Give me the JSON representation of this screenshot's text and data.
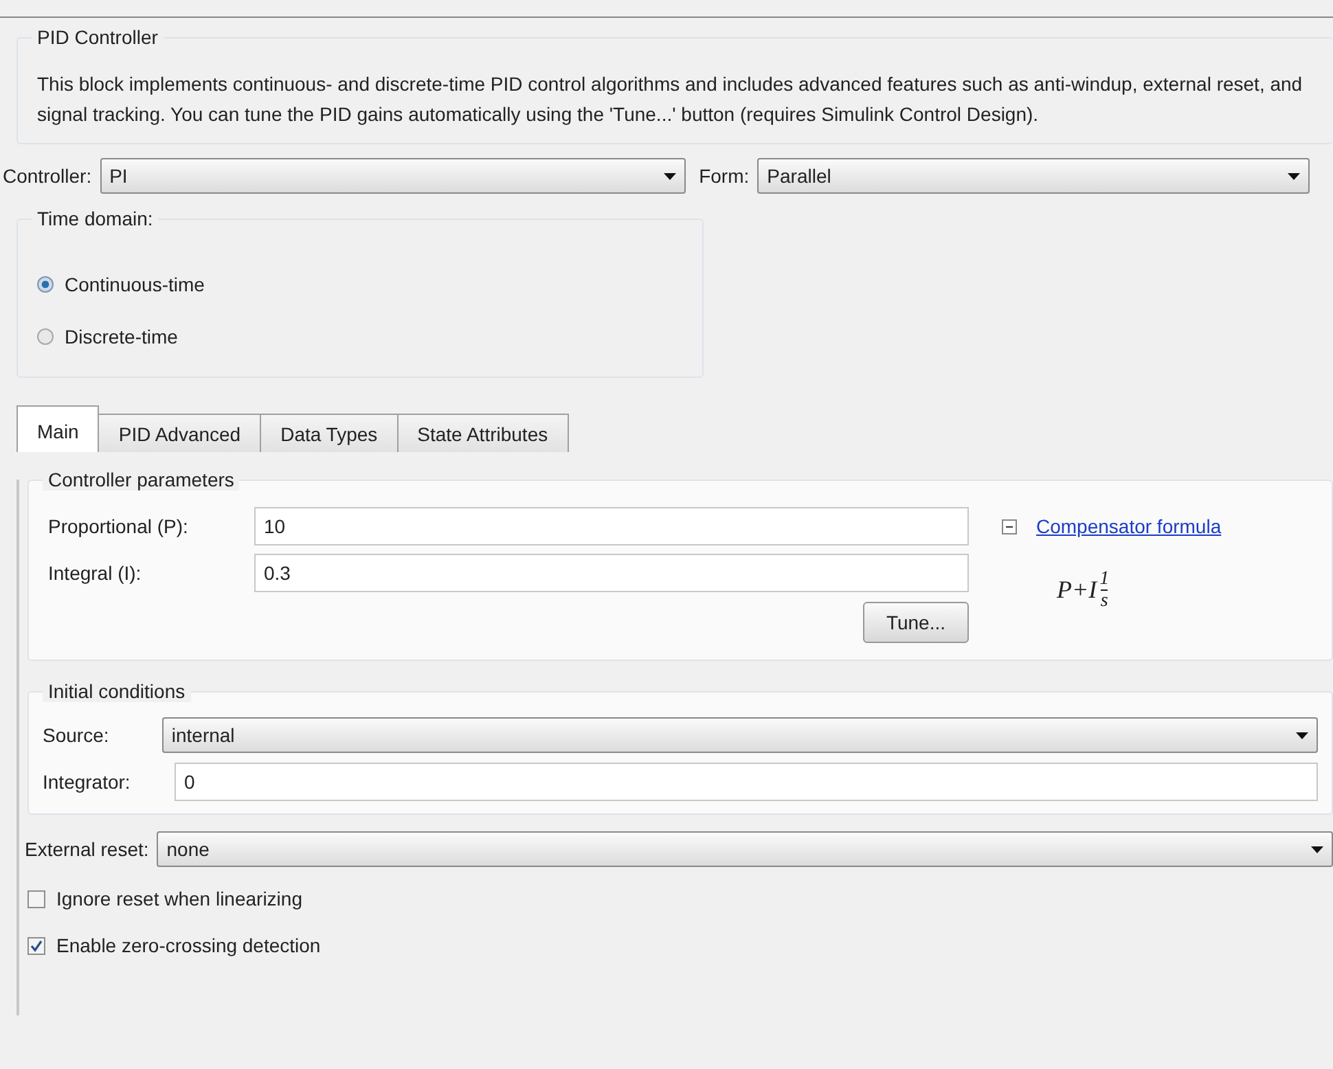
{
  "block": {
    "title": "PID Controller",
    "description": "This block implements continuous- and discrete-time PID control algorithms and includes advanced features such as anti-windup, external reset, and signal tracking. You can tune the PID gains automatically using the 'Tune...' button (requires Simulink Control Design)."
  },
  "controller": {
    "label": "Controller:",
    "value": "PI"
  },
  "form": {
    "label": "Form:",
    "value": "Parallel"
  },
  "time_domain": {
    "title": "Time domain:",
    "options": [
      {
        "label": "Continuous-time",
        "selected": true
      },
      {
        "label": "Discrete-time",
        "selected": false
      }
    ]
  },
  "tabs": [
    {
      "label": "Main",
      "selected": true
    },
    {
      "label": "PID Advanced",
      "selected": false
    },
    {
      "label": "Data Types",
      "selected": false
    },
    {
      "label": "State Attributes",
      "selected": false
    }
  ],
  "controller_parameters": {
    "title": "Controller parameters",
    "fields": [
      {
        "label": "Proportional (P):",
        "value": "10"
      },
      {
        "label": "Integral (I):",
        "value": "0.3"
      }
    ],
    "tune_button": "Tune...",
    "formula_link": "Compensator formula",
    "formula": {
      "terms": "P+I",
      "numerator": "1",
      "denominator": "s"
    }
  },
  "initial_conditions": {
    "title": "Initial conditions",
    "source": {
      "label": "Source:",
      "value": "internal"
    },
    "integrator": {
      "label": "Integrator:",
      "value": "0"
    }
  },
  "external_reset": {
    "label": "External reset:",
    "value": "none"
  },
  "checkboxes": [
    {
      "label": "Ignore reset when linearizing",
      "checked": false
    },
    {
      "label": "Enable zero-crossing detection",
      "checked": true
    }
  ]
}
